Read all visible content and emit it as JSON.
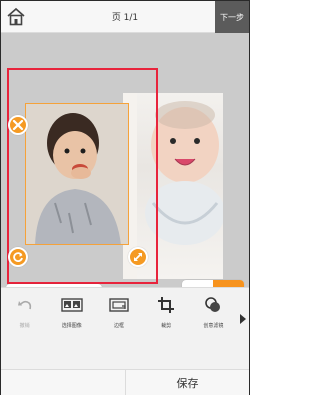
{
  "header": {
    "home_icon": "home-icon",
    "title": "页 1/1",
    "next_label": "下一步"
  },
  "canvas": {
    "photos": [
      {
        "name": "photo-baby-left",
        "description_icon": "photo"
      },
      {
        "name": "photo-baby-right",
        "description_icon": "photo"
      }
    ],
    "handles": {
      "close_icon": "close-icon",
      "rotate_icon": "rotate-icon",
      "resize_icon": "resize-icon"
    },
    "zoom": {
      "grid_icon": "grid-icon",
      "zoom_out_icon": "zoom-out-icon",
      "zoom_in_icon": "zoom-in-icon"
    },
    "mode": {
      "hand_icon": "hand-icon",
      "arrow_icon": "pointer-icon",
      "active": "pointer"
    }
  },
  "toolbar": {
    "items": [
      {
        "label": "撤销",
        "icon": "undo-icon",
        "disabled": true
      },
      {
        "label": "选择图像",
        "icon": "select-image-icon",
        "disabled": false
      },
      {
        "label": "边框",
        "icon": "frame-icon",
        "disabled": false
      },
      {
        "label": "裁剪",
        "icon": "crop-icon",
        "disabled": false
      },
      {
        "label": "创意滤镜",
        "icon": "filter-icon",
        "disabled": false
      }
    ],
    "more_icon": "chevron-right-icon"
  },
  "bottom": {
    "save_label": "保存"
  },
  "colors": {
    "accent": "#f7931e",
    "selection": "#e8243c",
    "header_bg": "#f7f7f7",
    "next_bg": "#5b5b5b"
  }
}
